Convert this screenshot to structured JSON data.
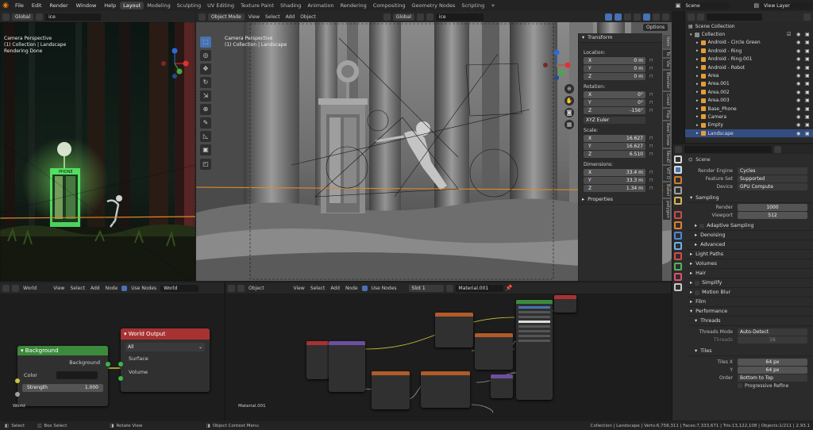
{
  "menus": [
    "File",
    "Edit",
    "Render",
    "Window",
    "Help"
  ],
  "workspaces": [
    "Layout",
    "Modeling",
    "Sculpting",
    "UV Editing",
    "Texture Paint",
    "Shading",
    "Animation",
    "Rendering",
    "Compositing",
    "Geometry Nodes",
    "Scripting"
  ],
  "active_workspace": "Layout",
  "scene": "Scene",
  "view_layer": "View Layer",
  "left_view": {
    "orientation": "Global",
    "search": "ice",
    "overlay": [
      "Camera Perspective",
      "(1) Collection | Landscape",
      "Rendering Done"
    ]
  },
  "main_view": {
    "mode": "Object Mode",
    "menus": [
      "View",
      "Select",
      "Add",
      "Object"
    ],
    "orientation": "Global",
    "search": "ice",
    "overlay": [
      "Camera Perspective",
      "(1) Collection | Landscape"
    ],
    "options": "Options"
  },
  "npanel": {
    "title": "Transform",
    "location_label": "Location:",
    "location": [
      {
        "axis": "X",
        "val": "0 m"
      },
      {
        "axis": "Y",
        "val": "0 m"
      },
      {
        "axis": "Z",
        "val": "0 m"
      }
    ],
    "rotation_label": "Rotation:",
    "rotation": [
      {
        "axis": "X",
        "val": "0°"
      },
      {
        "axis": "Y",
        "val": "0°"
      },
      {
        "axis": "Z",
        "val": "-156°"
      }
    ],
    "rot_mode": "XYZ Euler",
    "scale_label": "Scale:",
    "scale": [
      {
        "axis": "X",
        "val": "16.627"
      },
      {
        "axis": "Y",
        "val": "16.627"
      },
      {
        "axis": "Z",
        "val": "6.510"
      }
    ],
    "dim_label": "Dimensions:",
    "dimensions": [
      {
        "axis": "X",
        "val": "33.4 m"
      },
      {
        "axis": "Y",
        "val": "33.3 m"
      },
      {
        "axis": "Z",
        "val": "1.34 m"
      }
    ],
    "properties": "Properties",
    "side_tabs": [
      "Item",
      "To",
      "Vie",
      "Blender",
      "Creat",
      "Fbp",
      "Real Snow",
      "NeuD",
      "VIT O",
      "Bakel",
      "polygon"
    ]
  },
  "outliner": {
    "title": "Scene Collection",
    "items": [
      {
        "name": "Collection",
        "indent": 0,
        "color": "#8c8c8c"
      },
      {
        "name": "Android - Circle Green",
        "indent": 1,
        "color": "#e59d3b"
      },
      {
        "name": "Android - Ring",
        "indent": 1,
        "color": "#e59d3b"
      },
      {
        "name": "Android - Ring.001",
        "indent": 1,
        "color": "#e59d3b"
      },
      {
        "name": "Android - Robot",
        "indent": 1,
        "color": "#e59d3b"
      },
      {
        "name": "Area",
        "indent": 1,
        "color": "#e59d3b"
      },
      {
        "name": "Area.001",
        "indent": 1,
        "color": "#e59d3b"
      },
      {
        "name": "Area.002",
        "indent": 1,
        "color": "#e59d3b"
      },
      {
        "name": "Area.003",
        "indent": 1,
        "color": "#e59d3b"
      },
      {
        "name": "Base_Phone",
        "indent": 1,
        "color": "#e59d3b"
      },
      {
        "name": "Camera",
        "indent": 1,
        "color": "#e59d3b"
      },
      {
        "name": "Empty",
        "indent": 1,
        "color": "#e59d3b"
      },
      {
        "name": "Landscape",
        "indent": 1,
        "color": "#e59d3b"
      }
    ],
    "selected": "Landscape"
  },
  "properties": {
    "scene": "Scene",
    "render_engine_label": "Render Engine",
    "render_engine": "Cycles",
    "feature_set_label": "Feature Set",
    "feature_set": "Supported",
    "device_label": "Device",
    "device": "GPU Compute",
    "sampling": "Sampling",
    "render_label": "Render",
    "render_val": "1000",
    "viewport_label": "Viewport",
    "viewport_val": "512",
    "adaptive": "Adaptive Sampling",
    "denoising": "Denoising",
    "advanced": "Advanced",
    "light_paths": "Light Paths",
    "volumes": "Volumes",
    "hair": "Hair",
    "simplify": "Simplify",
    "motion_blur": "Motion Blur",
    "film": "Film",
    "performance": "Performance",
    "threads": "Threads",
    "threads_mode_label": "Threads Mode",
    "threads_mode": "Auto-Detect",
    "threads_label": "Threads",
    "threads_val": "16",
    "tiles": "Tiles",
    "tiles_x_label": "Tiles X",
    "tiles_x": "64 px",
    "tiles_y_label": "Y",
    "tiles_y": "64 px",
    "order_label": "Order",
    "order": "Bottom to Top",
    "progressive": "Progressive Refine"
  },
  "world_editor": {
    "type": "World",
    "menus": [
      "View",
      "Select",
      "Add",
      "Node"
    ],
    "use_nodes": "Use Nodes",
    "world_name": "World",
    "bg_node": {
      "title": "Background",
      "output": "Background",
      "color_label": "Color",
      "strength_label": "Strength",
      "strength": "1.000"
    },
    "out_node": {
      "title": "World Output",
      "target": "All",
      "surface": "Surface",
      "volume": "Volume"
    },
    "corner": "World"
  },
  "shader_editor": {
    "type": "Object",
    "menus": [
      "View",
      "Select",
      "Add",
      "Node"
    ],
    "use_nodes": "Use Nodes",
    "slot": "Slot 1",
    "material": "Material.001",
    "corner": "Material.001"
  },
  "status": {
    "left": [
      {
        "icon": "mouse",
        "text": "Select"
      },
      {
        "icon": "mouse",
        "text": "Box Select"
      },
      {
        "icon": "mouse",
        "text": "Rotate View"
      },
      {
        "icon": "mouse",
        "text": "Object Context Menu"
      }
    ],
    "right": "Collection | Landscape | Verts:6,758,311 | Faces:7,333,671 | Tris:13,122,108 | Objects:1/211 | 2.93.1"
  }
}
